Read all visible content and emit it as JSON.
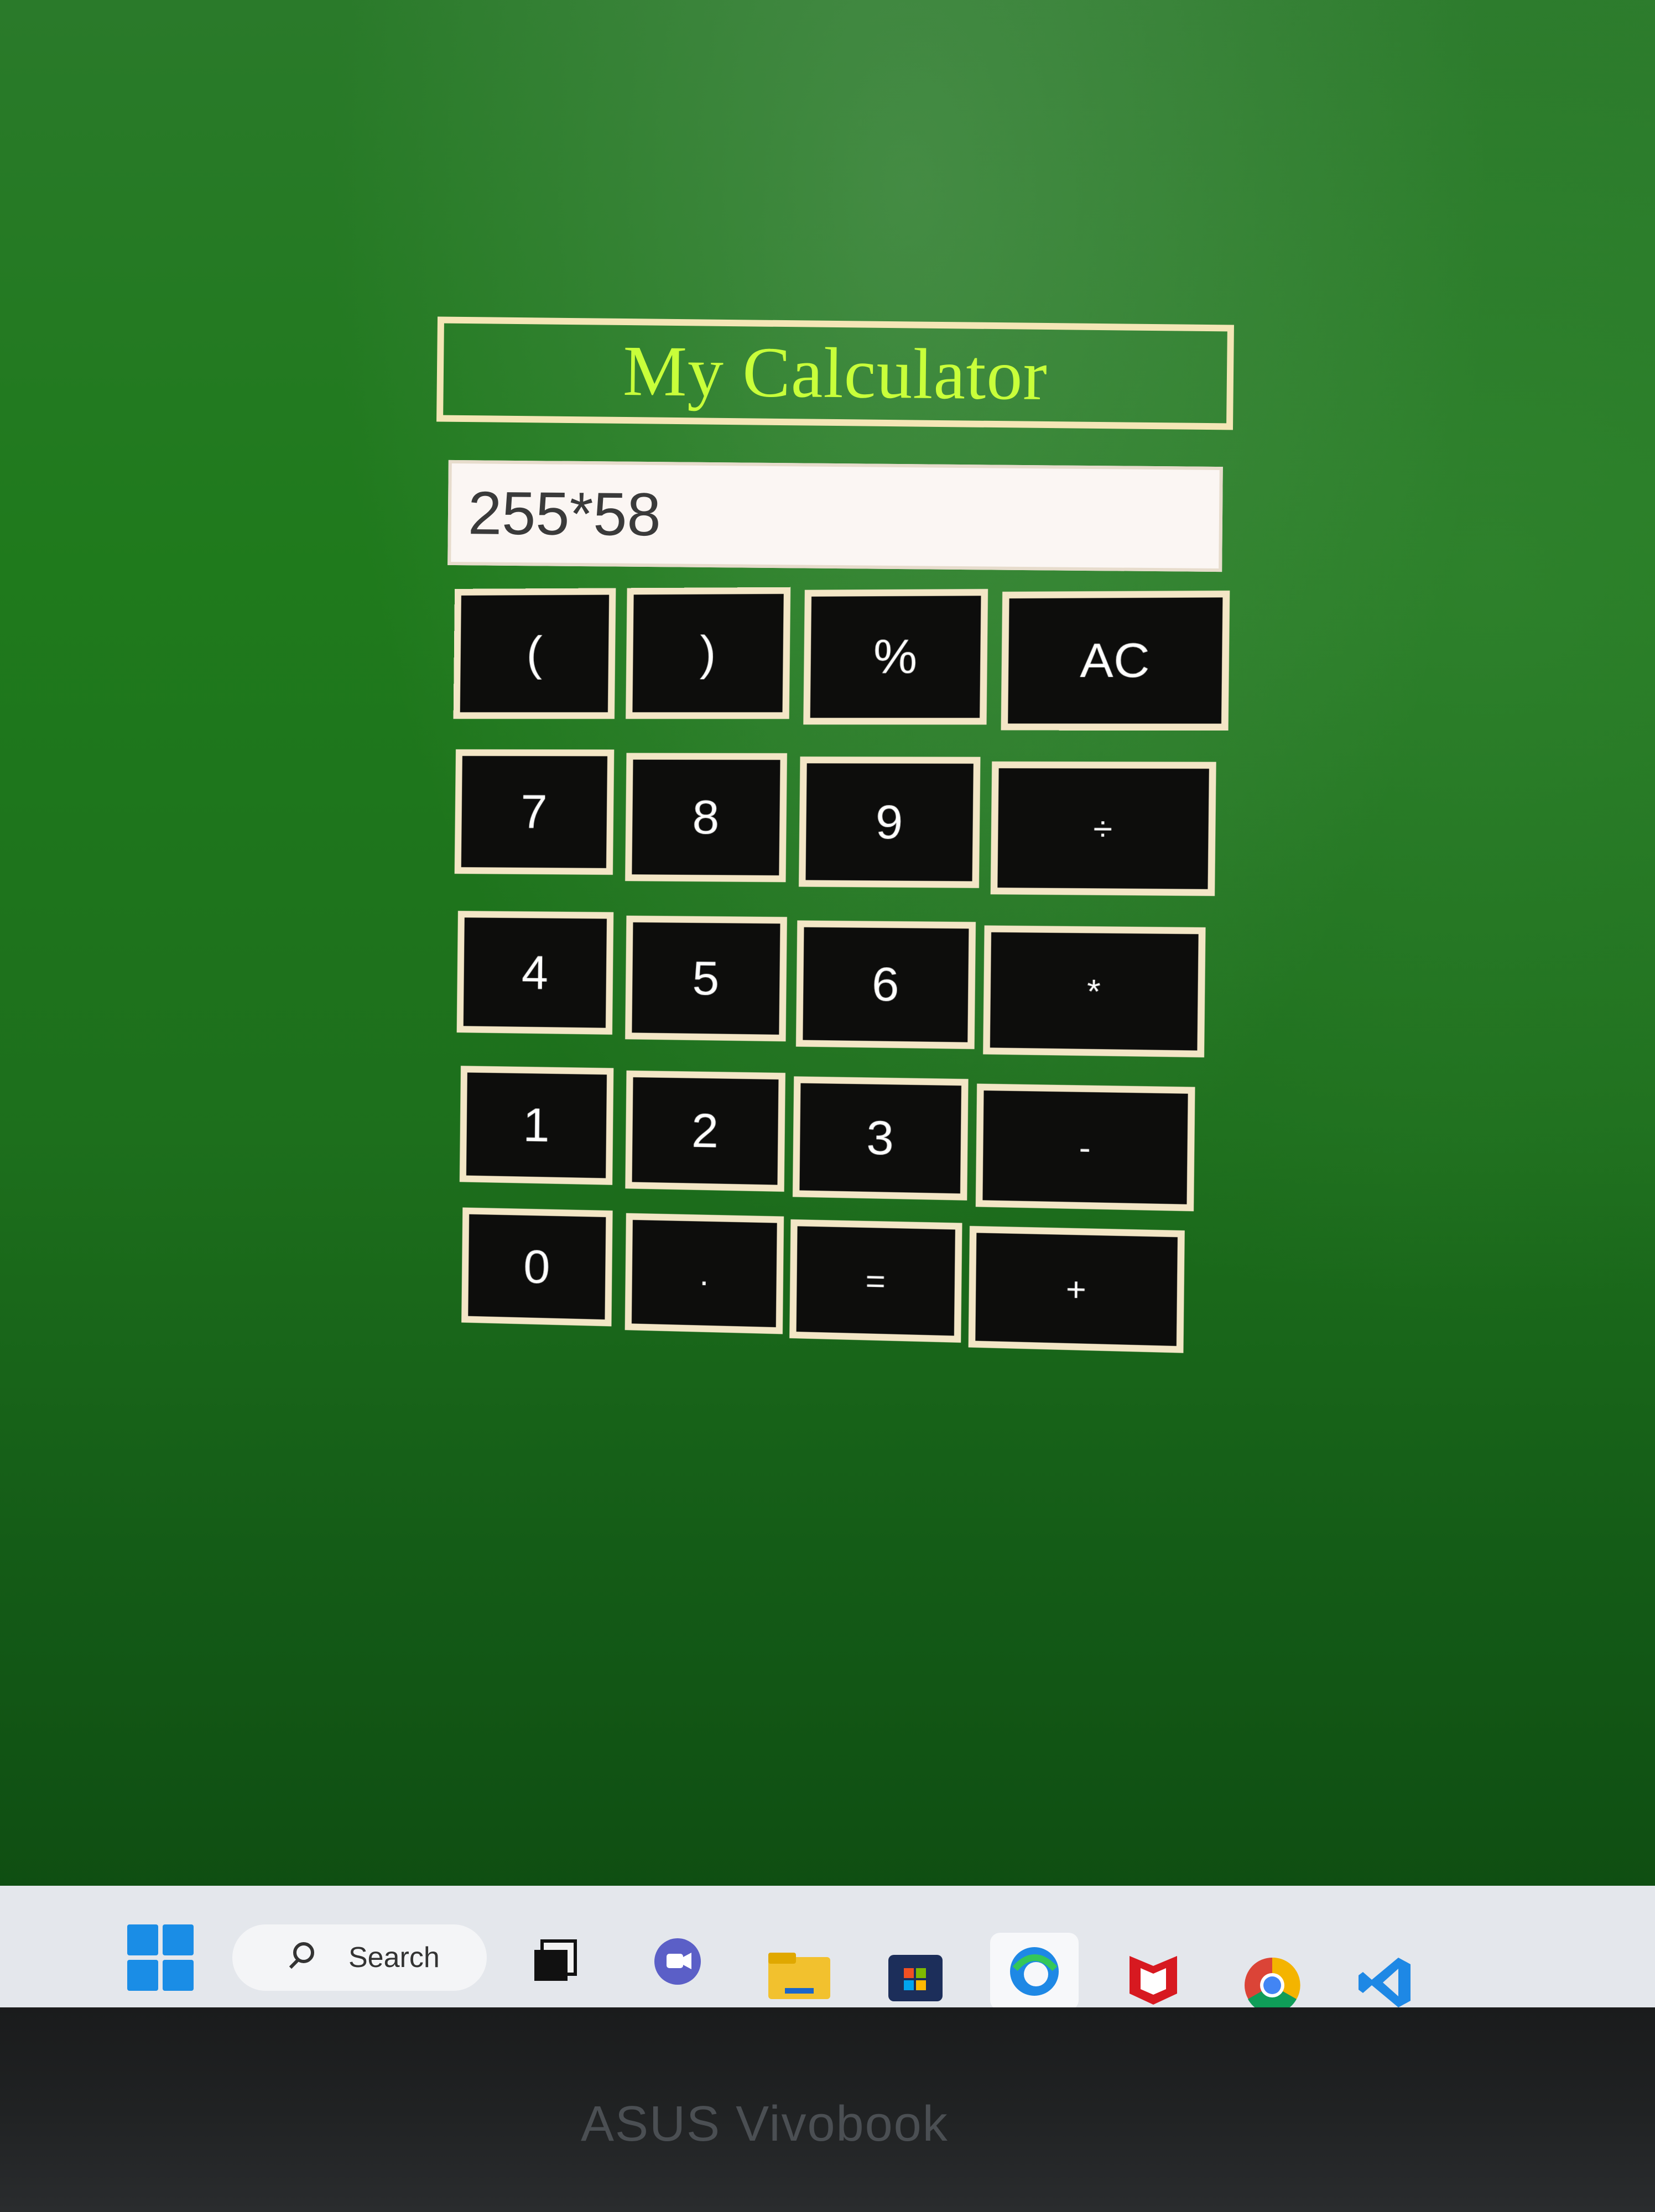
{
  "app": {
    "title": "My Calculator"
  },
  "display": {
    "value": "255*58"
  },
  "keys": {
    "row1": [
      "(",
      ")",
      "%",
      "AC"
    ],
    "row2": [
      "7",
      "8",
      "9",
      "÷"
    ],
    "row3": [
      "4",
      "5",
      "6",
      "*"
    ],
    "row4": [
      "1",
      "2",
      "3",
      "-"
    ],
    "row5": [
      "0",
      ".",
      "=",
      "+"
    ]
  },
  "taskbar": {
    "search_label": "Search",
    "icons": [
      "windows-start-icon",
      "task-view-icon",
      "chat-icon",
      "file-explorer-icon",
      "store-icon",
      "edge-icon",
      "mcafee-icon",
      "chrome-icon",
      "vscode-icon"
    ]
  },
  "bezel": {
    "brand": "ASUS Vivobook"
  },
  "colors": {
    "background_green": "#1f7a1c",
    "title_text": "#c8ff3a",
    "key_background": "#0d0d0c",
    "key_border": "#f3e6c6",
    "display_background": "#fbf6f3"
  }
}
